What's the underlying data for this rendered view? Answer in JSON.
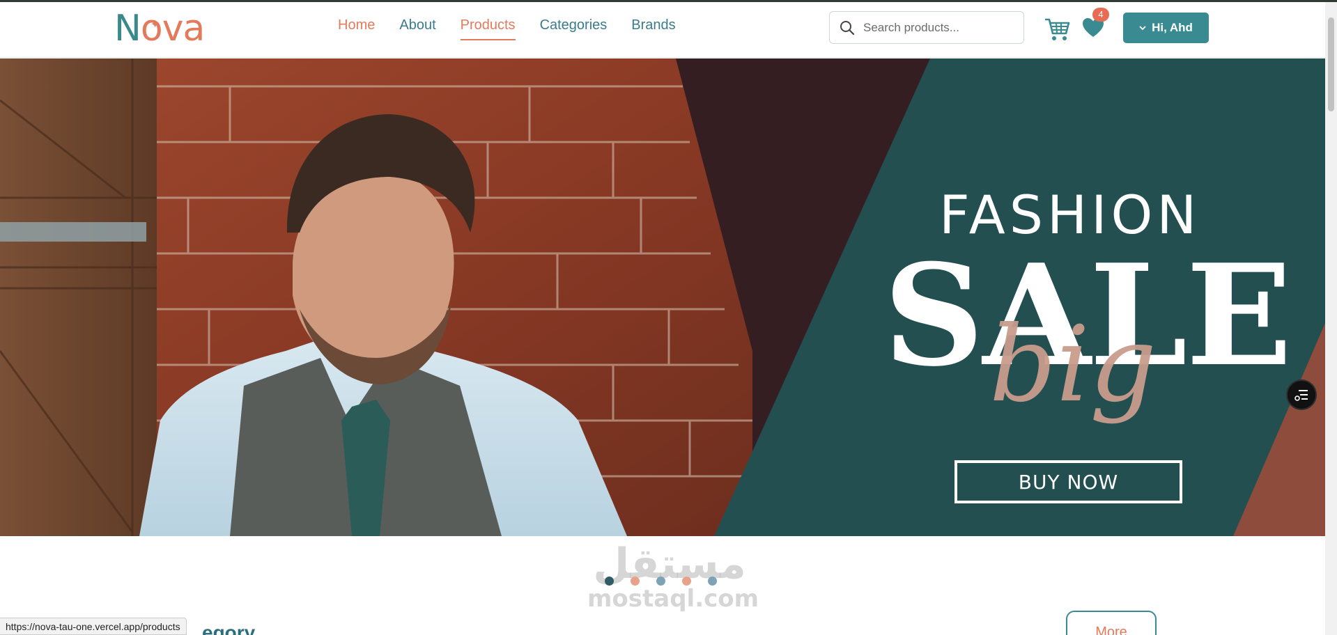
{
  "brand": {
    "logo_n": "N",
    "logo_o": "o",
    "logo_rest": "va",
    "logo_spark": "✦"
  },
  "nav": {
    "links": [
      {
        "label": "Home"
      },
      {
        "label": "About"
      },
      {
        "label": "Products"
      },
      {
        "label": "Categories"
      },
      {
        "label": "Brands"
      }
    ],
    "active": "Products"
  },
  "search": {
    "placeholder": "Search products...",
    "value": ""
  },
  "icons": {
    "search": "search-icon",
    "cart": "cart-icon",
    "wishlist": "heart-icon",
    "user_menu": "chevron-down-icon",
    "floating": "list-settings-icon"
  },
  "wishlist": {
    "count": "4"
  },
  "user": {
    "greeting": "Hi, Ahd"
  },
  "hero": {
    "line1": "FASHION",
    "line2": "SALE",
    "script": "big",
    "cta": "BUY NOW"
  },
  "slider": {
    "dot_count": 5,
    "active_index": 0
  },
  "watermark": {
    "arabic": "مستقل",
    "english": "mostaql.com"
  },
  "section": {
    "heading_visible": "egory",
    "more_label": "More"
  },
  "status_bar": {
    "url": "https://nova-tau-one.vercel.app/products"
  },
  "colors": {
    "teal": "#3a8a92",
    "coral": "#e37a5c",
    "hero_dark": "#341e22",
    "hero_teal": "#234f51",
    "hero_rust": "#8e4c3c"
  }
}
